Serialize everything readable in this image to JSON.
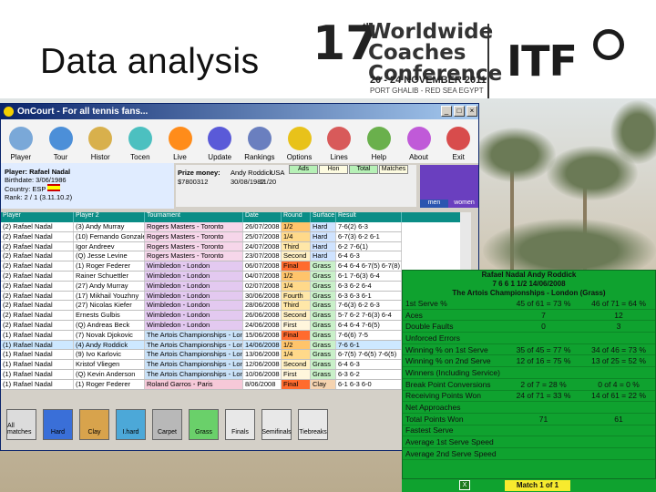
{
  "slide": {
    "title": "Data analysis",
    "logo": {
      "number": "17",
      "suffix": "th",
      "line1": "Worldwide",
      "line2": "Coaches",
      "line3": "Conference",
      "dates": "20 - 24 NOVEMBER 2011",
      "place": "PORT GHALIB - RED SEA EGYPT",
      "brand": "ITF"
    }
  },
  "app": {
    "window_title": "OnCourt - For all tennis fans...",
    "toolbar": [
      "Player",
      "Tour",
      "Histor",
      "Tocen",
      "Live",
      "Update",
      "Rankings",
      "Options",
      "Lines",
      "Help",
      "About",
      "Exit"
    ],
    "player_info": {
      "player": "Player: Rafael Nadal",
      "birth": "Birthdate: 3/06/1986",
      "country": "Country: ESP",
      "rank": "Rank: 2 / 1 (3.11.10.2)",
      "prize": "Prize money:",
      "prize_val": "$7800312"
    },
    "top_stats": {
      "opponent": "Andy Roddick",
      "date": "30/08/1982",
      "country": "USA",
      "score": "11/20",
      "tabs": [
        "Ads",
        "Hon",
        "Total",
        "Matches"
      ]
    },
    "vs_tabs": [
      "men",
      "women"
    ],
    "grid_headers": [
      "Player",
      "Player 2",
      "Tournament",
      "Date",
      "Round",
      "Surface",
      "Result"
    ],
    "grid_rows": [
      [
        "(2) Rafael Nadal",
        "(3) Andy Murray",
        "Rogers Masters - Toronto",
        "26/07/2008",
        "1/2",
        "Hard",
        "7-6(2) 6-3"
      ],
      [
        "(2) Rafael Nadal",
        "(10) Fernando Gonzalez",
        "Rogers Masters - Toronto",
        "25/07/2008",
        "1/4",
        "Hard",
        "6-7(3) 6-2 6-1"
      ],
      [
        "(2) Rafael Nadal",
        "Igor Andreev",
        "Rogers Masters - Toronto",
        "24/07/2008",
        "Third",
        "Hard",
        "6-2 7-6(1)"
      ],
      [
        "(2) Rafael Nadal",
        "(Q) Jesse Levine",
        "Rogers Masters - Toronto",
        "23/07/2008",
        "Second",
        "Hard",
        "6-4 6-3"
      ],
      [
        "(2) Rafael Nadal",
        "(1) Roger Federer",
        "Wimbledon - London",
        "06/07/2008",
        "Final",
        "Grass",
        "6-4 6-4 6-7(5) 6-7(8) 9-7"
      ],
      [
        "(2) Rafael Nadal",
        "Rainer Schuettler",
        "Wimbledon - London",
        "04/07/2008",
        "1/2",
        "Grass",
        "6-1 7-6(3) 6-4"
      ],
      [
        "(2) Rafael Nadal",
        "(27) Andy Murray",
        "Wimbledon - London",
        "02/07/2008",
        "1/4",
        "Grass",
        "6-3 6-2 6-4"
      ],
      [
        "(2) Rafael Nadal",
        "(17) Mikhail Youzhny",
        "Wimbledon - London",
        "30/06/2008",
        "Fourth",
        "Grass",
        "6-3 6-3 6-1"
      ],
      [
        "(2) Rafael Nadal",
        "(27) Nicolas Kiefer",
        "Wimbledon - London",
        "28/06/2008",
        "Third",
        "Grass",
        "7-6(3) 6-2 6-3"
      ],
      [
        "(2) Rafael Nadal",
        "Ernests Gulbis",
        "Wimbledon - London",
        "26/06/2008",
        "Second",
        "Grass",
        "5-7 6-2 7-6(3) 6-4"
      ],
      [
        "(2) Rafael Nadal",
        "(Q) Andreas Beck",
        "Wimbledon - London",
        "24/06/2008",
        "First",
        "Grass",
        "6-4 6-4 7-6(5)"
      ],
      [
        "(1) Rafael Nadal",
        "(7) Novak Djokovic",
        "The Artois Championships - London",
        "15/06/2008",
        "Final",
        "Grass",
        "7-6(6) 7-5"
      ],
      [
        "(1) Rafael Nadal",
        "(4) Andy Roddick",
        "The Artois Championships - London",
        "14/06/2008",
        "1/2",
        "Grass",
        "7-6 6-1"
      ],
      [
        "(1) Rafael Nadal",
        "(9) Ivo Karlovic",
        "The Artois Championships - London",
        "13/06/2008",
        "1/4",
        "Grass",
        "6-7(5) 7-6(5) 7-6(5)"
      ],
      [
        "(1) Rafael Nadal",
        "Kristof Vliegen",
        "The Artois Championships - London",
        "12/06/2008",
        "Second",
        "Grass",
        "6-4 6-3"
      ],
      [
        "(1) Rafael Nadal",
        "(Q) Kevin Anderson",
        "The Artois Championships - London",
        "10/06/2008",
        "First",
        "Grass",
        "6-3 6-2"
      ],
      [
        "(1) Rafael Nadal",
        "(1) Roger Federer",
        "Roland Garros - Paris",
        "8/06/2008",
        "Final",
        "Clay",
        "6-1 6-3 6-0"
      ]
    ],
    "filters": [
      "All matches",
      "Hard",
      "Clay",
      "I.hard",
      "Carpet",
      "Grass",
      "Finals",
      "Semifinals",
      "Tiebreaks"
    ]
  },
  "stats": {
    "header_names": "Rafael Nadal    Andy Roddick",
    "header_score": "7 6 6 1    1/2    14/06/2008",
    "header_event": "The Artois Championships - London (Grass)",
    "rows": [
      [
        "1st Serve %",
        "45 of 61 = 73 %",
        "46 of 71 = 64 %"
      ],
      [
        "Aces",
        "7",
        "12"
      ],
      [
        "Double Faults",
        "0",
        "3"
      ],
      [
        "Unforced Errors",
        "",
        ""
      ],
      [
        "Winning % on 1st Serve",
        "35 of 45 = 77 %",
        "34 of 46 = 73 %"
      ],
      [
        "Winning % on 2nd Serve",
        "12 of 16 = 75 %",
        "13 of 25 = 52 %"
      ],
      [
        "Winners (Including Service)",
        "",
        ""
      ],
      [
        "Break Point Conversions",
        "2 of 7 = 28 %",
        "0 of 4 = 0 %"
      ],
      [
        "Receiving Points Won",
        "24 of 71 = 33 %",
        "14 of 61 = 22 %"
      ],
      [
        "Net Approaches",
        "",
        ""
      ],
      [
        "Total Points Won",
        "71",
        "61"
      ],
      [
        "Fastest Serve",
        "",
        ""
      ],
      [
        "Average 1st Serve Speed",
        "",
        ""
      ],
      [
        "Average 2nd Serve Speed",
        "",
        ""
      ]
    ],
    "footer_match": "Match 1 of 1"
  }
}
